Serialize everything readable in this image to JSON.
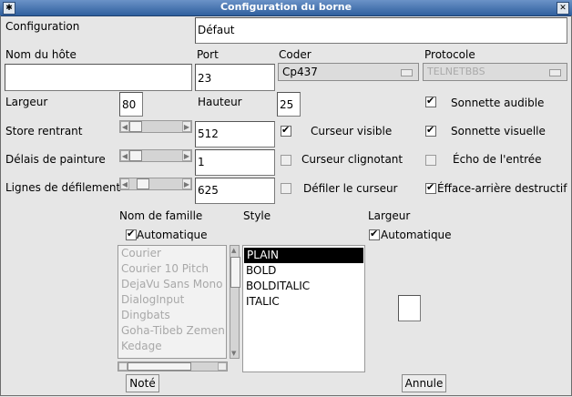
{
  "window": {
    "title": "Configuration du borne",
    "pin_glyph": "✱",
    "close_glyph": "✕"
  },
  "config": {
    "label": "Configuration",
    "value": "Défaut"
  },
  "host": {
    "label": "Nom du hôte",
    "value": ""
  },
  "port": {
    "label": "Port",
    "value": "23"
  },
  "coder": {
    "label": "Coder",
    "value": "Cp437"
  },
  "protocol": {
    "label": "Protocole",
    "value": "TELNETBBS"
  },
  "width": {
    "label": "Largeur",
    "value": "80"
  },
  "height": {
    "label": "Hauteur",
    "value": "25"
  },
  "bell_audible": {
    "label": "Sonnette audible",
    "checked": true
  },
  "store": {
    "label": "Store rentrant",
    "value": "512"
  },
  "cursor_visible": {
    "label": "Curseur visible",
    "checked": true
  },
  "bell_visual": {
    "label": "Sonnette visuelle",
    "checked": true
  },
  "paint_delay": {
    "label": "Délais de painture",
    "value": "1"
  },
  "cursor_blink": {
    "label": "Curseur clignotant",
    "checked": false
  },
  "echo": {
    "label": "Écho de l'entrée",
    "checked": false
  },
  "scroll_lines": {
    "label": "Lignes de défilement",
    "value": "625"
  },
  "scroll_cursor": {
    "label": "Défiler le curseur",
    "checked": false
  },
  "backspace": {
    "label": "Éfface-arrière destructif",
    "checked": true
  },
  "font": {
    "family_label": "Nom de famille",
    "style_label": "Style",
    "size_label": "Largeur",
    "auto_family_label": "Automatique",
    "auto_size_label": "Automatique",
    "families": [
      "Courier",
      "Courier 10 Pitch",
      "DejaVu Sans Mono",
      "DialogInput",
      "Dingbats",
      "Goha-Tibeb Zemen",
      "Kedage"
    ],
    "styles": [
      "PLAIN",
      "BOLD",
      "BOLDITALIC",
      "ITALIC"
    ],
    "selected_style": "PLAIN"
  },
  "buttons": {
    "ok": "Noté",
    "cancel": "Annule"
  }
}
